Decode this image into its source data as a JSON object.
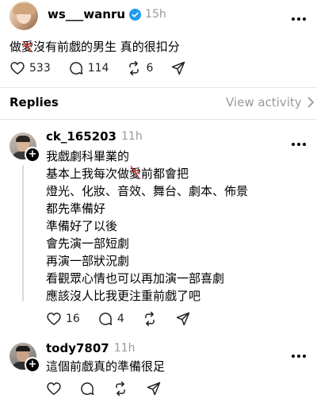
{
  "post": {
    "username": "ws___wanru",
    "time": "15h",
    "text_before": "做",
    "text_struck": "愛",
    "text_after": "沒有前戲的男生 真的很扣分",
    "likes": "533",
    "comments": "114",
    "reposts": "6"
  },
  "replies_header": {
    "title": "Replies",
    "view_activity": "View activity"
  },
  "reply1": {
    "username": "ck_165203",
    "time": "11h",
    "line1": "我戲劇科畢業的",
    "line2_before": "基本上我每次做",
    "line2_struck": "愛",
    "line2_after": "前都會把",
    "line3": "燈光、化妝、音效、舞台、劇本、佈景",
    "line4": "都先準備好",
    "line5": "準備好了以後",
    "line6": "會先演一部短劇",
    "line7": "再演一部狀況劇",
    "line8": "看觀眾心情也可以再加演一部喜劇",
    "line9": "應該沒人比我更注重前戲了吧",
    "likes": "16",
    "comments": "4"
  },
  "reply2": {
    "username": "tody7807",
    "time": "11h",
    "text": "這個前戲真的準備很足"
  },
  "colors": {
    "verified": "#1d9bf0",
    "strike": "#e0302a",
    "muted": "#999999"
  }
}
